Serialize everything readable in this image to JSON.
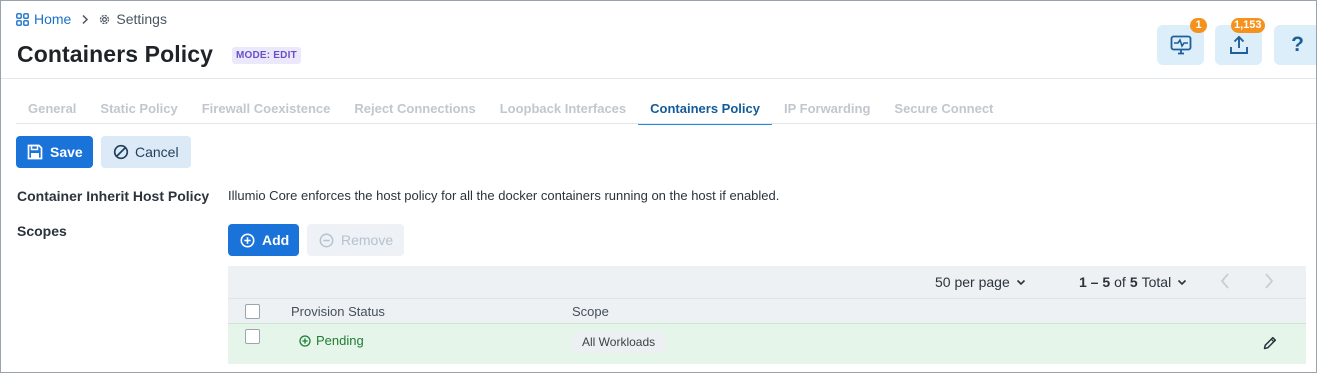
{
  "breadcrumb": {
    "home": "Home",
    "settings": "Settings"
  },
  "page": {
    "title": "Containers Policy",
    "mode": "MODE: EDIT"
  },
  "header_buttons": {
    "health_badge": "1",
    "provision_badge": "1,153",
    "help_label": "?",
    "badge_color": "#f5921e"
  },
  "tabs": [
    {
      "label": "General",
      "active": false
    },
    {
      "label": "Static Policy",
      "active": false
    },
    {
      "label": "Firewall Coexistence",
      "active": false
    },
    {
      "label": "Reject Connections",
      "active": false
    },
    {
      "label": "Loopback Interfaces",
      "active": false
    },
    {
      "label": "Containers Policy",
      "active": true
    },
    {
      "label": "IP Forwarding",
      "active": false
    },
    {
      "label": "Secure Connect",
      "active": false
    }
  ],
  "toolbar": {
    "save": "Save",
    "cancel": "Cancel"
  },
  "fields": {
    "inherit_label": "Container Inherit Host Policy",
    "inherit_desc": "Illumio Core enforces the host policy for all the docker containers running on the host if enabled.",
    "scopes_label": "Scopes"
  },
  "scopes_toolbar": {
    "add": "Add",
    "remove": "Remove"
  },
  "grid": {
    "per_page": "50 per page",
    "range": "1 – 5",
    "of": "of",
    "total_count": "5",
    "total": "Total",
    "columns": [
      "Provision Status",
      "Scope"
    ],
    "rows": [
      {
        "status": "Pending",
        "scope": "All Workloads"
      }
    ]
  },
  "colors": {
    "accent": "#1a73d9",
    "pending": "#1e7d35",
    "mode_badge": "#6a4fc7"
  }
}
